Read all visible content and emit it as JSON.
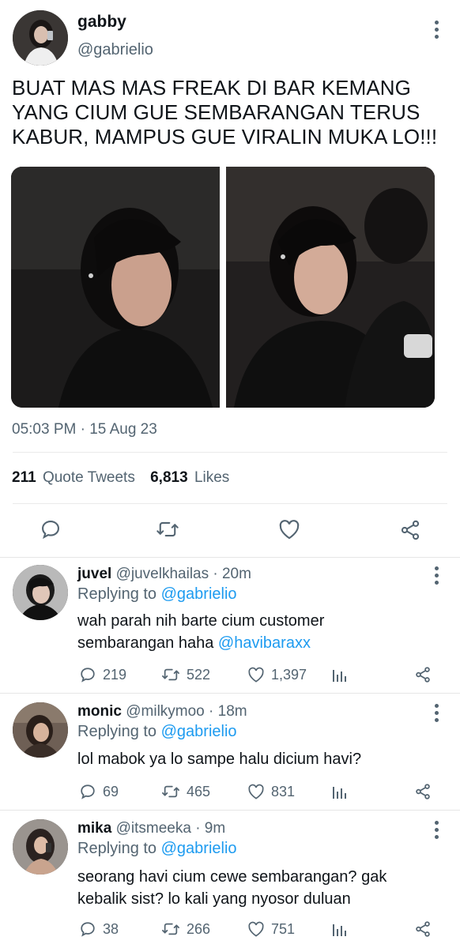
{
  "main_tweet": {
    "display_name": "gabby",
    "handle": "@gabrielio",
    "text_lines": [
      "BUAT MAS MAS FREAK DI BAR KEMANG",
      "YANG CIUM GUE SEMBARANGAN TERUS",
      "KABUR, MAMPUS GUE VIRALIN MUKA LO!!!"
    ],
    "timestamp": "05:03 PM · 15 Aug 23",
    "quote_count": "211",
    "quote_label": "Quote Tweets",
    "likes_count": "6,813",
    "likes_label": "Likes"
  },
  "replies": [
    {
      "name": "juvel",
      "handle_time": "@juvelkhailas · 20m",
      "replying_label": "Replying to",
      "replying_to": "@gabrielio",
      "text_line1": "wah parah nih barte cium customer",
      "text_line2_plain": "sembarangan haha ",
      "text_line2_mention": "@havibaraxx",
      "replies": "219",
      "retweets": "522",
      "likes": "1,397"
    },
    {
      "name": "monic",
      "handle_time": "@milkymoo · 18m",
      "replying_label": "Replying to",
      "replying_to": "@gabrielio",
      "text_line1": "lol mabok ya lo sampe halu dicium havi?",
      "replies": "69",
      "retweets": "465",
      "likes": "831"
    },
    {
      "name": "mika",
      "handle_time": "@itsmeeka · 9m",
      "replying_label": "Replying to",
      "replying_to": "@gabrielio",
      "text_line1": "seorang havi cium cewe sembarangan? gak",
      "text_line2": "kebalik sist? lo kali yang nyosor duluan",
      "replies": "38",
      "retweets": "266",
      "likes": "751"
    }
  ],
  "colors": {
    "link": "#1d9bf0",
    "muted": "#536471",
    "text": "#0f1419"
  }
}
